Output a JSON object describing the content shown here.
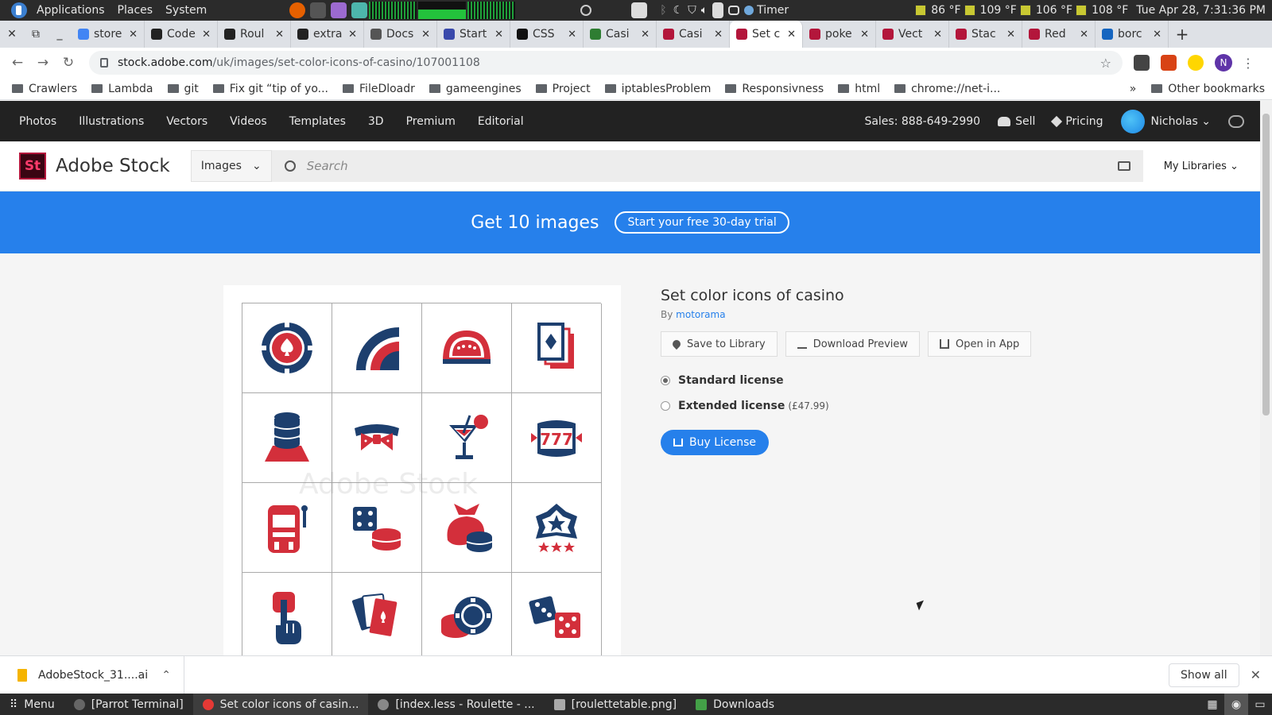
{
  "os_top": {
    "menu": [
      "Applications",
      "Places",
      "System"
    ],
    "timer_label": "Timer",
    "temps": [
      "86 °F",
      "109 °F",
      "106 °F",
      "108 °F"
    ],
    "clock": "Tue Apr 28, 7:31:36 PM"
  },
  "tabs": [
    {
      "title": "store",
      "color": "#4285f4"
    },
    {
      "title": "Code",
      "color": "#222"
    },
    {
      "title": "Roul",
      "color": "#222"
    },
    {
      "title": "extra",
      "color": "#222"
    },
    {
      "title": "Docs",
      "color": "#555"
    },
    {
      "title": "Start",
      "color": "#3949ab"
    },
    {
      "title": "CSS",
      "color": "#111"
    },
    {
      "title": "Casi",
      "color": "#2e7d32"
    },
    {
      "title": "Casi",
      "color": "#b3163b"
    },
    {
      "title": "Set c",
      "color": "#b3163b",
      "active": true
    },
    {
      "title": "poke",
      "color": "#b3163b"
    },
    {
      "title": "Vect",
      "color": "#b3163b"
    },
    {
      "title": "Stac",
      "color": "#b3163b"
    },
    {
      "title": "Red",
      "color": "#b3163b"
    },
    {
      "title": "borc",
      "color": "#1565c0"
    }
  ],
  "omnibox": {
    "host": "stock.adobe.com",
    "path": "/uk/images/set-color-icons-of-casino/107001108"
  },
  "profile_initial": "N",
  "bookmarks": [
    "Crawlers",
    "Lambda",
    "git",
    "Fix git “tip of yo...",
    "FileDloadr",
    "gameengines",
    "Project",
    "iptablesProblem",
    "Responsivness",
    "html",
    "chrome://net-i..."
  ],
  "other_bookmarks": "Other bookmarks",
  "adobe_nav": {
    "links": [
      "Photos",
      "Illustrations",
      "Vectors",
      "Videos",
      "Templates",
      "3D",
      "Premium",
      "Editorial"
    ],
    "sales": "Sales: 888-649-2990",
    "sell": "Sell",
    "pricing": "Pricing",
    "user": "Nicholas"
  },
  "header": {
    "logo_text": "St",
    "brand": "Adobe Stock",
    "type_select": "Images",
    "search_placeholder": "Search",
    "my_libraries": "My Libraries"
  },
  "promo": {
    "text": "Get 10 images",
    "cta": "Start your free 30-day trial"
  },
  "asset": {
    "title": "Set color icons of casino",
    "by_label": "By",
    "author": "motorama",
    "watermark": "Adobe Stock",
    "actions": [
      "Save to Library",
      "Download Preview",
      "Open in App"
    ],
    "licenses": [
      {
        "label": "Standard license",
        "selected": true,
        "price": ""
      },
      {
        "label": "Extended license",
        "selected": false,
        "price": "(£47.99)"
      }
    ],
    "buy": "Buy License",
    "icons": [
      "poker-chip-icon",
      "roulette-wheel-icon",
      "casino-table-icon",
      "playing-cards-icon",
      "chip-stack-icon",
      "bow-tie-icon",
      "cocktail-icon",
      "slot-777-icon",
      "slot-machine-icon",
      "dice-and-chips-icon",
      "money-bag-icon",
      "star-badge-icon",
      "finger-press-icon",
      "card-hand-icon",
      "chip-coins-icon",
      "two-dice-icon"
    ],
    "colors": {
      "red": "#d32f3b",
      "blue": "#1d3f6e"
    }
  },
  "download_bar": {
    "file": "AdobeStock_31....ai",
    "show_all": "Show all"
  },
  "taskbar": {
    "menu": "Menu",
    "items": [
      "[Parrot Terminal]",
      "Set color icons of casin...",
      "[index.less - Roulette - ...",
      "[roulettetable.png]",
      "Downloads"
    ]
  }
}
